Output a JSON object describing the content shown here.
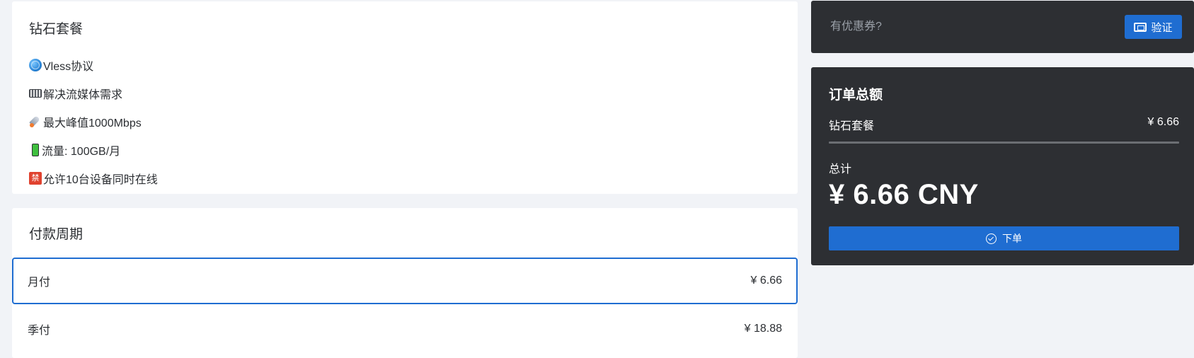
{
  "plan": {
    "title": "钻石套餐",
    "features": [
      {
        "icon": "globe-icon",
        "text": "Vless协议"
      },
      {
        "icon": "keyboard-icon",
        "text": "解决流媒体需求"
      },
      {
        "icon": "rocket-icon",
        "text": "最大峰值1000Mbps"
      },
      {
        "icon": "battery-icon",
        "text": "流量: 100GB/月"
      },
      {
        "icon": "prohibited-icon",
        "text": "允许10台设备同时在线",
        "icon_glyph": "禁"
      }
    ]
  },
  "period": {
    "title": "付款周期",
    "options": [
      {
        "label": "月付",
        "price": "¥ 6.66",
        "selected": true
      },
      {
        "label": "季付",
        "price": "¥ 18.88",
        "selected": false
      }
    ]
  },
  "coupon": {
    "placeholder": "有优惠券?",
    "value": "",
    "verify_label": "验证"
  },
  "order": {
    "title": "订单总额",
    "line_item": {
      "name": "钻石套餐",
      "price": "¥ 6.66"
    },
    "total_label": "总计",
    "total_amount": "¥ 6.66 CNY",
    "submit_label": "下单"
  },
  "colors": {
    "accent": "#1f6dd1",
    "dark_panel": "#2d2f33",
    "page_bg": "#f1f3f7"
  }
}
